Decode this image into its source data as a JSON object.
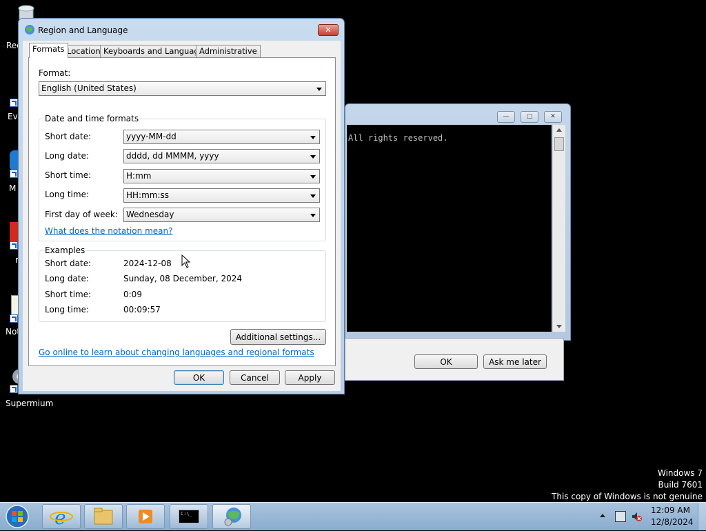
{
  "desktop": {
    "icons": [
      {
        "label": "Rec"
      },
      {
        "label": "Eve"
      },
      {
        "label": "M"
      },
      {
        "label": "r"
      },
      {
        "label": "Not"
      },
      {
        "label": "Supermium"
      }
    ]
  },
  "console": {
    "text": "All rights reserved.",
    "min_label": "—",
    "max_label": "□",
    "close_label": "✕"
  },
  "ask_dialog": {
    "ok_label": "OK",
    "later_label": "Ask me later"
  },
  "dialog": {
    "title": "Region and Language",
    "close_label": "✕",
    "tabs": [
      {
        "label": "Formats"
      },
      {
        "label": "Location"
      },
      {
        "label": "Keyboards and Languages"
      },
      {
        "label": "Administrative"
      }
    ],
    "format_label": "Format:",
    "format_value": "English (United States)",
    "dt_group_label": "Date and time formats",
    "dt_rows": [
      {
        "label": "Short date:",
        "value": "yyyy-MM-dd"
      },
      {
        "label": "Long date:",
        "value": "dddd, dd MMMM, yyyy"
      },
      {
        "label": "Short time:",
        "value": "H:mm"
      },
      {
        "label": "Long time:",
        "value": "HH:mm:ss"
      },
      {
        "label": "First day of week:",
        "value": "Wednesday"
      }
    ],
    "notation_link": "What does the notation mean?",
    "examples_label": "Examples",
    "examples": [
      {
        "label": "Short date:",
        "value": "2024-12-08"
      },
      {
        "label": "Long date:",
        "value": "Sunday, 08 December, 2024"
      },
      {
        "label": "Short time:",
        "value": "0:09"
      },
      {
        "label": "Long time:",
        "value": "00:09:57"
      }
    ],
    "additional_label": "Additional settings...",
    "online_link": "Go online to learn about changing languages and regional formats",
    "ok_label": "OK",
    "cancel_label": "Cancel",
    "apply_label": "Apply"
  },
  "watermark": {
    "line1": "Windows 7",
    "line2": "Build 7601",
    "line3": "This copy of Windows is not genuine"
  },
  "taskbar": {
    "time": "12:09 AM",
    "date": "12/8/2024",
    "cmd_glyph": "C:\\_",
    "items": [
      "start-orb",
      "internet-explorer",
      "file-explorer",
      "media-player",
      "command-prompt",
      "region-and-language"
    ]
  },
  "colors": {
    "accent": "#1a5fb4",
    "link": "#0066cc",
    "close_red": "#c5412e"
  }
}
